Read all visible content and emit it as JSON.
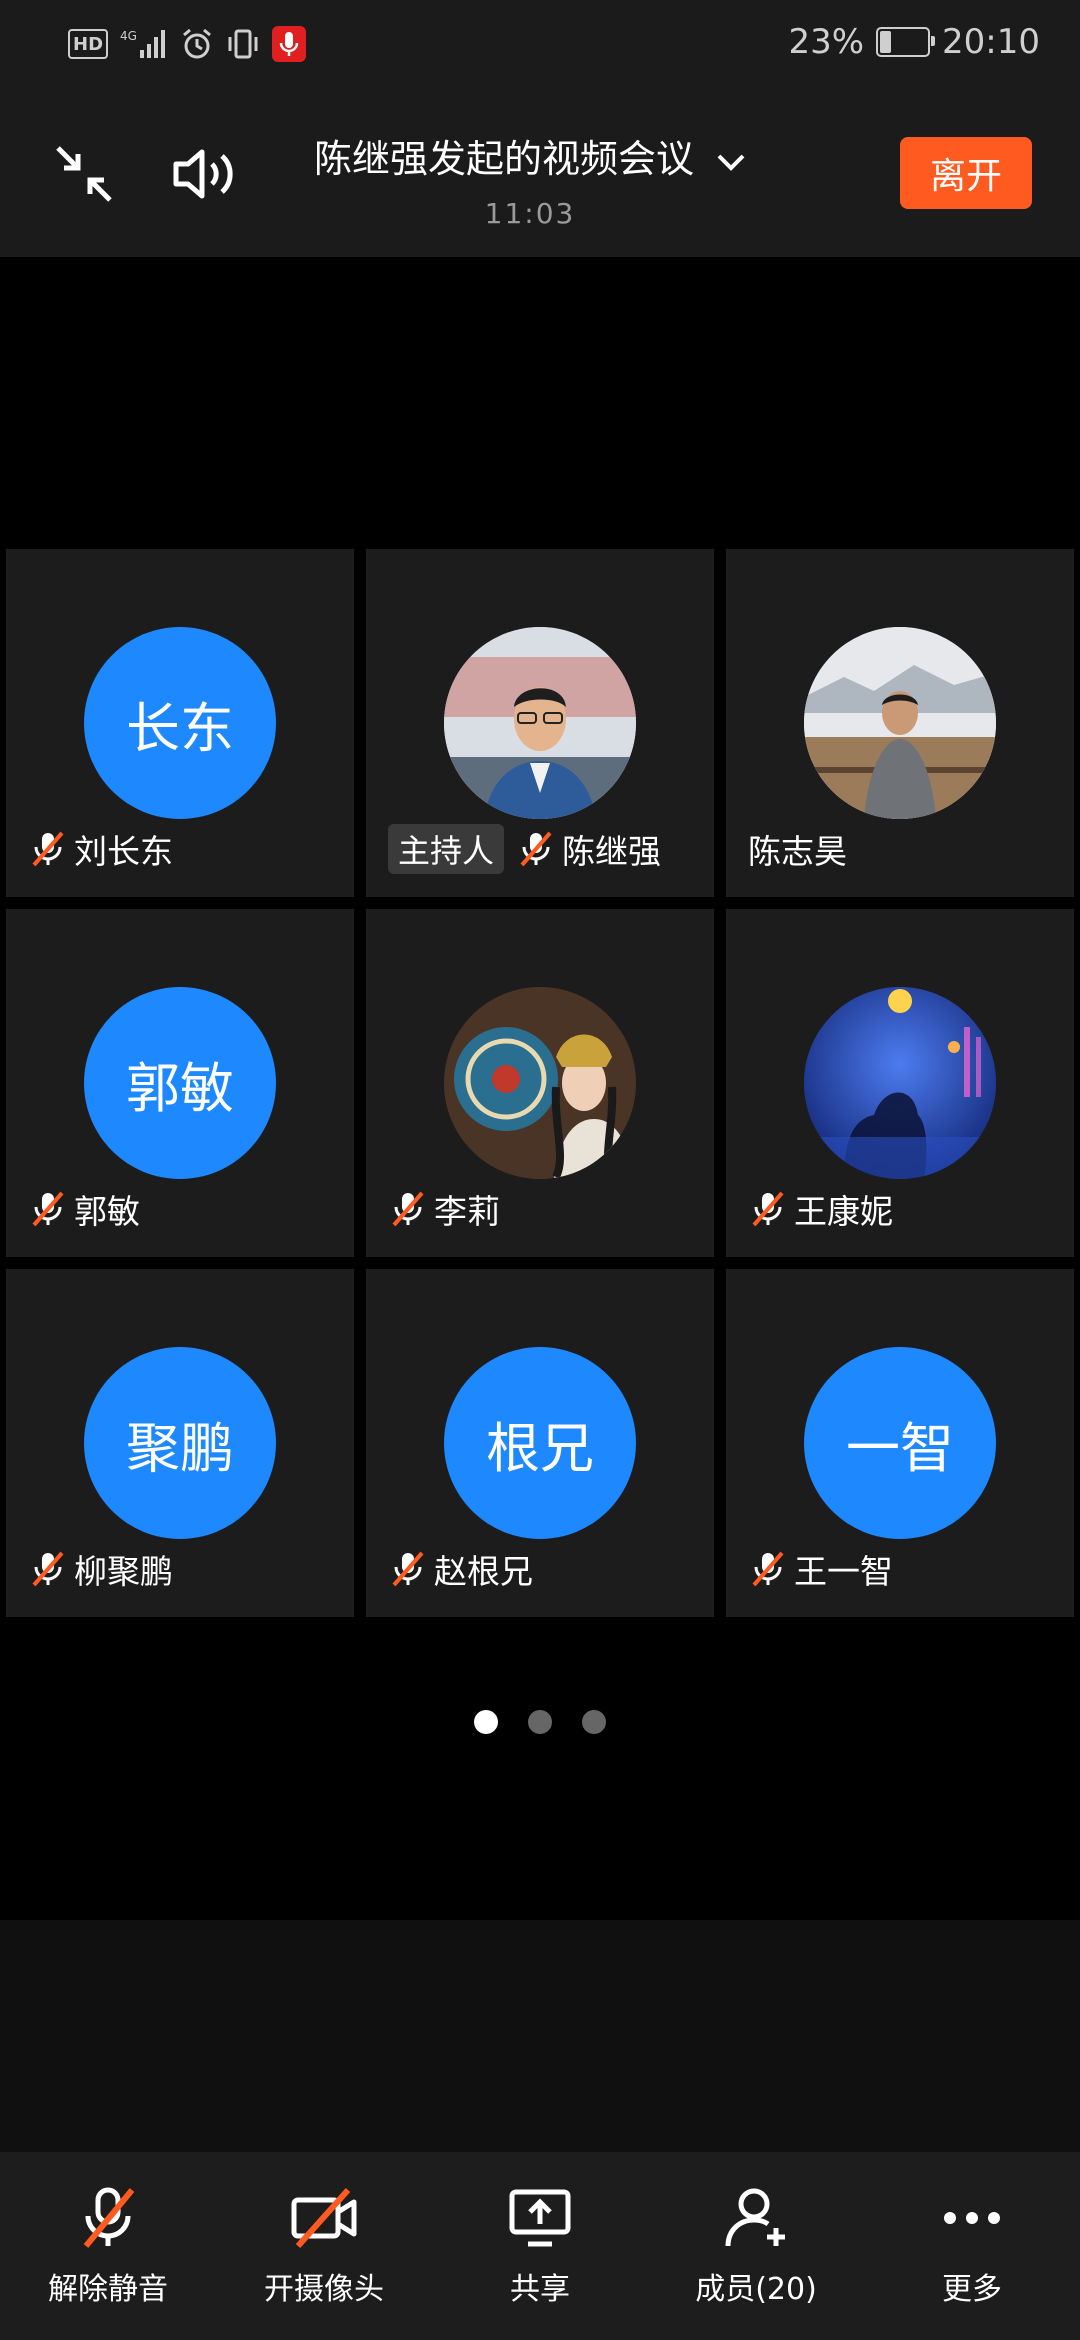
{
  "status_bar": {
    "battery_level": "23%",
    "time": "20:10",
    "icons": [
      "hd-icon",
      "signal-4g-icon",
      "alarm-icon",
      "vibrate-icon",
      "mic-recording-icon",
      "battery-charging-icon"
    ],
    "network": "4G",
    "hd_label": "HD"
  },
  "header": {
    "title": "陈继强发起的视频会议",
    "duration": "11:03",
    "leave_label": "离开"
  },
  "participants": [
    {
      "name": "刘长东",
      "avatar_text": "长东",
      "muted": true,
      "host": false
    },
    {
      "name": "陈继强",
      "avatar_text": "",
      "muted": true,
      "host": true,
      "host_label": "主持人"
    },
    {
      "name": "陈志昊",
      "avatar_text": "",
      "muted": false,
      "host": false
    },
    {
      "name": "郭敏",
      "avatar_text": "郭敏",
      "muted": true,
      "host": false
    },
    {
      "name": "李莉",
      "avatar_text": "",
      "muted": true,
      "host": false
    },
    {
      "name": "王康妮",
      "avatar_text": "",
      "muted": true,
      "host": false
    },
    {
      "name": "柳聚鹏",
      "avatar_text": "聚鹏",
      "muted": true,
      "host": false
    },
    {
      "name": "赵根兄",
      "avatar_text": "根兄",
      "muted": true,
      "host": false
    },
    {
      "name": "王一智",
      "avatar_text": "一智",
      "muted": true,
      "host": false
    }
  ],
  "pager": {
    "pages": 3,
    "current": 1
  },
  "toolbar": {
    "unmute": "解除静音",
    "camera": "开摄像头",
    "share": "共享",
    "members": "成员(20)",
    "more": "更多"
  },
  "colors": {
    "accent": "#1e88ff",
    "leave": "#ff5a1f",
    "muted": "#ff5a1f"
  }
}
